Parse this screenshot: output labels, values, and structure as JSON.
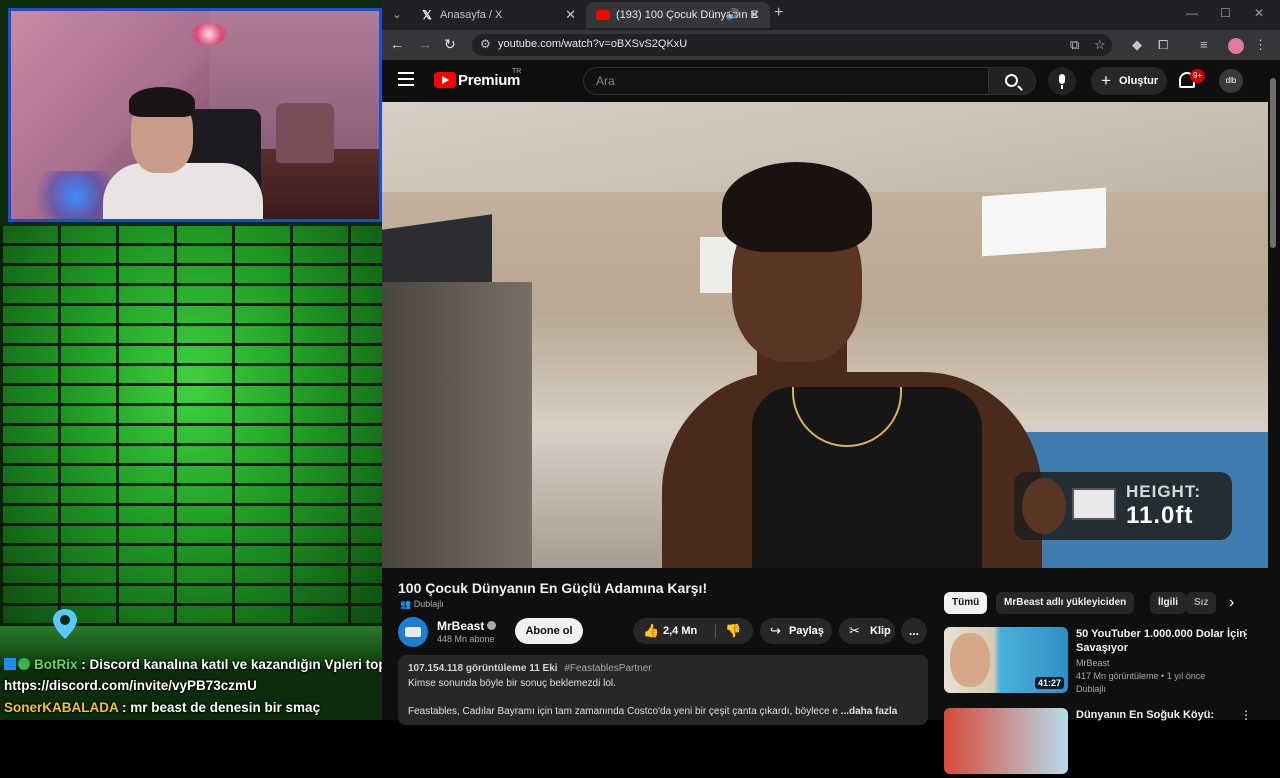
{
  "chat": {
    "line1_user": "BotRix",
    "line1_msg": ": Discord kanalına katıl ve kazandığın Vpleri topla...!",
    "line2": "https://discord.com/invite/vyPB73czmU",
    "line3_user": "SonerKABALADA",
    "line3_msg": " : mr beast de denesin bir smaç"
  },
  "browser": {
    "tabs": [
      {
        "label": "Anasayfa / X",
        "icon": "x-logo-icon"
      },
      {
        "label": "(193) 100 Çocuk Dünyanın E",
        "icon": "youtube-icon"
      }
    ],
    "url": "youtube.com/watch?v=oBXSvS2QKxU"
  },
  "youtube": {
    "brand": "Premium",
    "brand_region": "TR",
    "search_placeholder": "Ara",
    "create_label": "Oluştur",
    "notif_count": "9+",
    "avatar_text": "dlb",
    "accent": "#ff0000"
  },
  "video": {
    "overlay_label": "HEIGHT:",
    "overlay_value": "11.0ft",
    "title": "100 Çocuk Dünyanın En Güçlü Adamına Karşı!",
    "dubbed": "Dublajlı",
    "channel": "MrBeast",
    "subscribers": "448 Mn abone",
    "subscribe_label": "Abone ol",
    "likes": "2,4 Mn",
    "share_label": "Paylaş",
    "clip_label": "Klip",
    "more_label": "..."
  },
  "description": {
    "views": "107.154.118 görüntüleme",
    "date": "11 Eki",
    "hashtag": "#FeastablesPartner",
    "line2": "Kimse sonunda böyle bir sonuç beklemezdi lol.",
    "line3": "Feastables, Cadılar Bayramı için tam zamanında Costco'da yeni bir çeşit çanta çıkardı, böylece e",
    "more": "...daha fazla"
  },
  "sidebar": {
    "chips": [
      "Tümü",
      "MrBeast adlı yükleyiciden",
      "İlgili",
      "Sız"
    ],
    "recs": [
      {
        "title": "50 YouTuber 1.000.000 Dolar İçin Savaşıyor",
        "channel": "MrBeast",
        "stats": "417 Mn görüntüleme • 1 yıl önce",
        "dubbed": "Dublajlı",
        "duration": "41:27"
      },
      {
        "title": "Dünyanın En Soğuk Köyü:",
        "channel": "",
        "stats": "",
        "dubbed": "",
        "duration": ""
      }
    ]
  }
}
